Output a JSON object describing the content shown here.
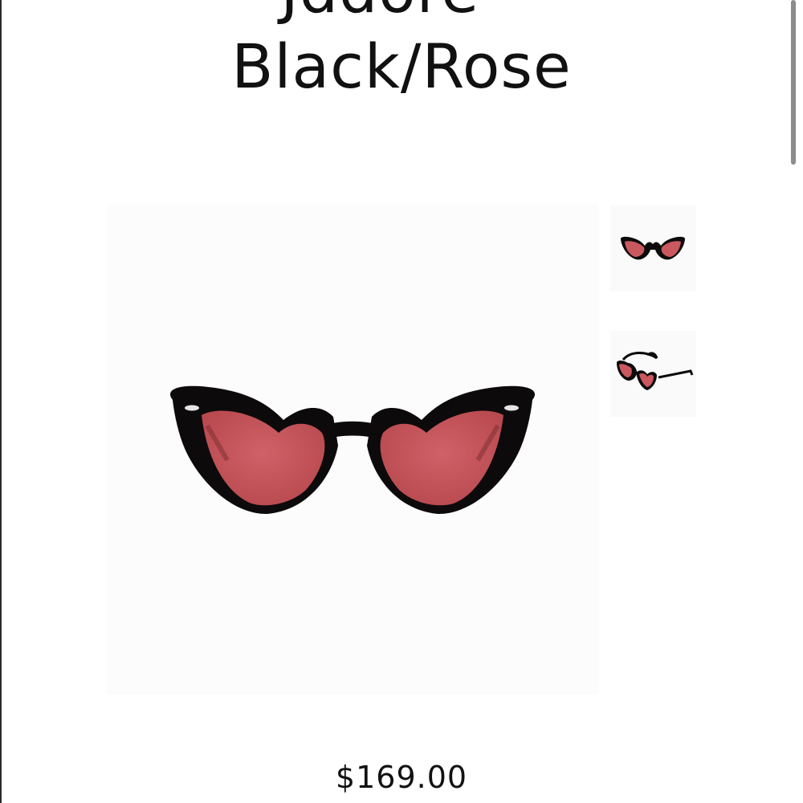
{
  "product": {
    "title_line1": "Jddore -",
    "title_line2": "Black/Rose",
    "price": "$169.00"
  },
  "gallery": {
    "main_image_icon": "heart-sunglasses-front-icon",
    "thumbnails": [
      {
        "icon": "heart-sunglasses-front-icon"
      },
      {
        "icon": "heart-sunglasses-angled-icon"
      }
    ]
  },
  "colors": {
    "frame": "#0d0a0b",
    "lens": "#c9585f",
    "background": "#ffffff",
    "image_background": "#fcfcfc"
  }
}
